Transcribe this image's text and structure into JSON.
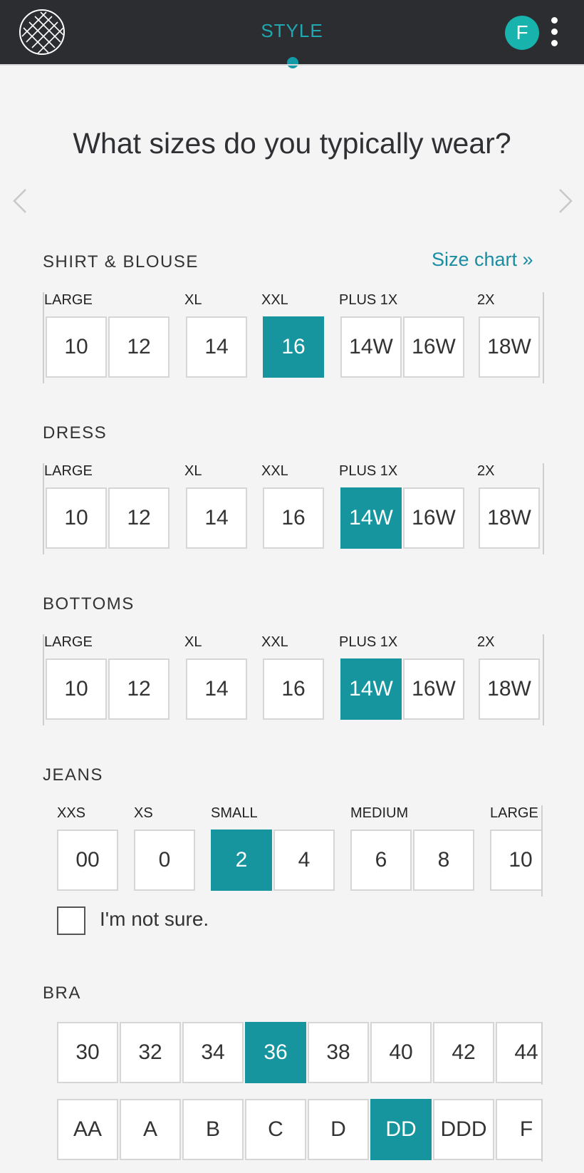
{
  "header": {
    "title": "STYLE",
    "avatar_initial": "F",
    "icons": [
      "logo-icon",
      "more-vert-icon"
    ],
    "accent_color": "#17959f"
  },
  "page": {
    "title": "What sizes do you typically wear?",
    "size_chart_link": "Size chart »"
  },
  "sections": {
    "shirt": {
      "title": "SHIRT & BLOUSE",
      "groups": [
        {
          "label": "LARGE",
          "sizes": [
            "10",
            "12"
          ]
        },
        {
          "label": "XL",
          "sizes": [
            "14"
          ]
        },
        {
          "label": "XXL",
          "sizes": [
            "16"
          ]
        },
        {
          "label": "PLUS 1X",
          "sizes": [
            "14W",
            "16W"
          ]
        },
        {
          "label": "2X",
          "sizes": [
            "18W"
          ]
        }
      ],
      "selected": "16"
    },
    "dress": {
      "title": "DRESS",
      "groups": [
        {
          "label": "LARGE",
          "sizes": [
            "10",
            "12"
          ]
        },
        {
          "label": "XL",
          "sizes": [
            "14"
          ]
        },
        {
          "label": "XXL",
          "sizes": [
            "16"
          ]
        },
        {
          "label": "PLUS 1X",
          "sizes": [
            "14W",
            "16W"
          ]
        },
        {
          "label": "2X",
          "sizes": [
            "18W"
          ]
        }
      ],
      "selected": "14W"
    },
    "bottoms": {
      "title": "BOTTOMS",
      "groups": [
        {
          "label": "LARGE",
          "sizes": [
            "10",
            "12"
          ]
        },
        {
          "label": "XL",
          "sizes": [
            "14"
          ]
        },
        {
          "label": "XXL",
          "sizes": [
            "16"
          ]
        },
        {
          "label": "PLUS 1X",
          "sizes": [
            "14W",
            "16W"
          ]
        },
        {
          "label": "2X",
          "sizes": [
            "18W"
          ]
        }
      ],
      "selected": "14W"
    },
    "jeans": {
      "title": "JEANS",
      "groups": [
        {
          "label": "XXS",
          "sizes": [
            "00"
          ]
        },
        {
          "label": "XS",
          "sizes": [
            "0"
          ]
        },
        {
          "label": "SMALL",
          "sizes": [
            "2",
            "4"
          ]
        },
        {
          "label": "MEDIUM",
          "sizes": [
            "6",
            "8"
          ]
        },
        {
          "label": "LARGE",
          "sizes": [
            "10"
          ]
        }
      ],
      "selected": "2",
      "not_sure_label": "I'm not sure.",
      "not_sure_checked": false
    },
    "bra": {
      "title": "BRA",
      "band_sizes": [
        "30",
        "32",
        "34",
        "36",
        "38",
        "40",
        "42",
        "44"
      ],
      "cup_sizes": [
        "AA",
        "A",
        "B",
        "C",
        "D",
        "DD",
        "DDD",
        "F"
      ],
      "selected_band": "36",
      "selected_cup": "DD"
    }
  }
}
